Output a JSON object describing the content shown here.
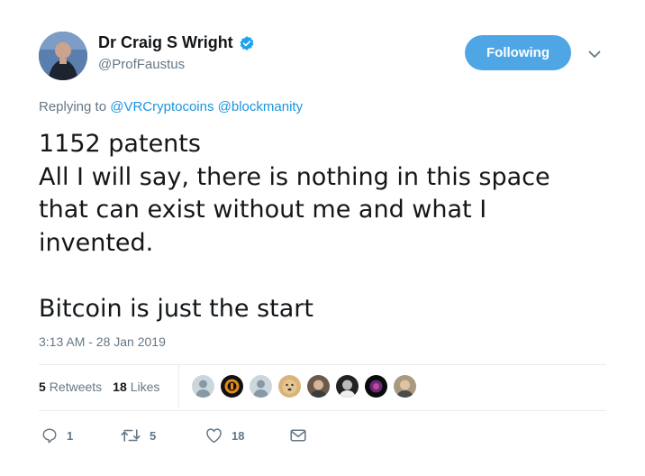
{
  "author": {
    "name": "Dr Craig S Wright",
    "handle": "@ProfFaustus",
    "verified": true
  },
  "follow_button": {
    "label": "Following"
  },
  "reply": {
    "prefix": "Replying to",
    "mentions": [
      "@VRCryptocoins",
      "@blockmanity"
    ]
  },
  "tweet": {
    "lines": [
      "1152 patents",
      "All I will say, there is nothing in this space",
      "that can exist without me and what I",
      "invented.",
      "",
      "Bitcoin is just the start"
    ]
  },
  "timestamp": "3:13 AM - 28 Jan 2019",
  "stats": {
    "retweets_count": "5",
    "retweets_label": "Retweets",
    "likes_count": "18",
    "likes_label": "Likes"
  },
  "actions": {
    "reply_count": "1",
    "retweet_count": "5",
    "like_count": "18"
  },
  "colors": {
    "accent": "#1b95e0",
    "follow_bg": "#4ea6e4",
    "muted": "#657786",
    "verified": "#1da1f2"
  },
  "icons": [
    "verified-badge",
    "chevron-down",
    "reply",
    "retweet",
    "heart",
    "envelope"
  ]
}
